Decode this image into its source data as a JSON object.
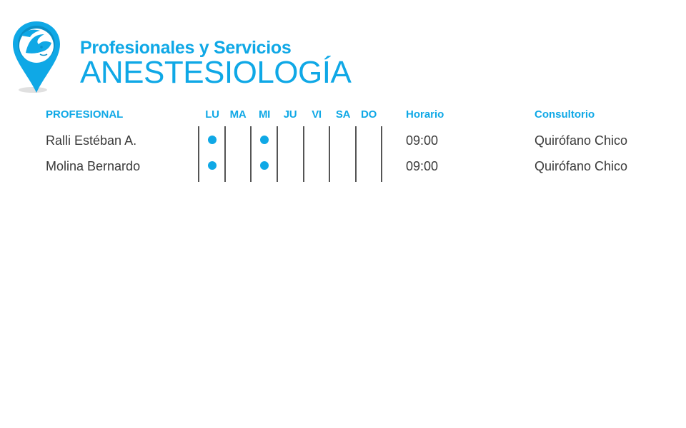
{
  "header": {
    "subtitle": "Profesionales y Servicios",
    "title": "ANESTESIOLOGÍA",
    "logo_icon": "map-pin-baby-icon"
  },
  "table": {
    "columns": {
      "profesional": "PROFESIONAL",
      "days": [
        "LU",
        "MA",
        "MI",
        "JU",
        "VI",
        "SA",
        "DO"
      ],
      "horario": "Horario",
      "consultorio": "Consultorio"
    },
    "rows": [
      {
        "profesional": "Ralli Estéban A.",
        "days_active": [
          true,
          false,
          true,
          false,
          false,
          false,
          false
        ],
        "horario": "09:00",
        "consultorio": "Quirófano Chico"
      },
      {
        "profesional": "Molina Bernardo",
        "days_active": [
          true,
          false,
          true,
          false,
          false,
          false,
          false
        ],
        "horario": "09:00",
        "consultorio": "Quirófano Chico"
      }
    ]
  },
  "colors": {
    "accent": "#0fa8e6",
    "text": "#3a3a3a",
    "divider": "#555555"
  }
}
